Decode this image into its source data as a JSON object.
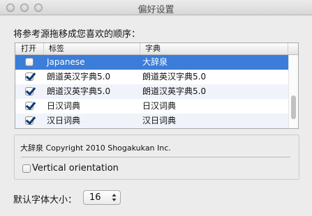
{
  "window": {
    "title": "偏好设置"
  },
  "instruction": "将参考源拖移成您喜欢的顺序：",
  "table": {
    "columns": [
      "打开",
      "标签",
      "字典"
    ],
    "rows": [
      {
        "checked": false,
        "label": "Japanese",
        "dict": "大辞泉",
        "selected": true
      },
      {
        "checked": true,
        "label": "朗道英汉字典5.0",
        "dict": "朗道英汉字典5.0",
        "selected": false
      },
      {
        "checked": true,
        "label": "朗道汉英字典5.0",
        "dict": "朗道汉英字典5.0",
        "selected": false
      },
      {
        "checked": true,
        "label": "日汉词典",
        "dict": "日汉词典",
        "selected": false
      },
      {
        "checked": true,
        "label": "汉日词典",
        "dict": "汉日词典",
        "selected": false
      }
    ]
  },
  "detail": {
    "copyright": "大辞泉 Copyright 2010 Shogakukan Inc.",
    "vertical_orientation_label": "Vertical orientation",
    "vertical_orientation_checked": false
  },
  "font_size": {
    "label": "默认字体大小：",
    "value": "16"
  },
  "colors": {
    "selection": "#3b7dd8",
    "checkmark": "#0d3a73"
  }
}
